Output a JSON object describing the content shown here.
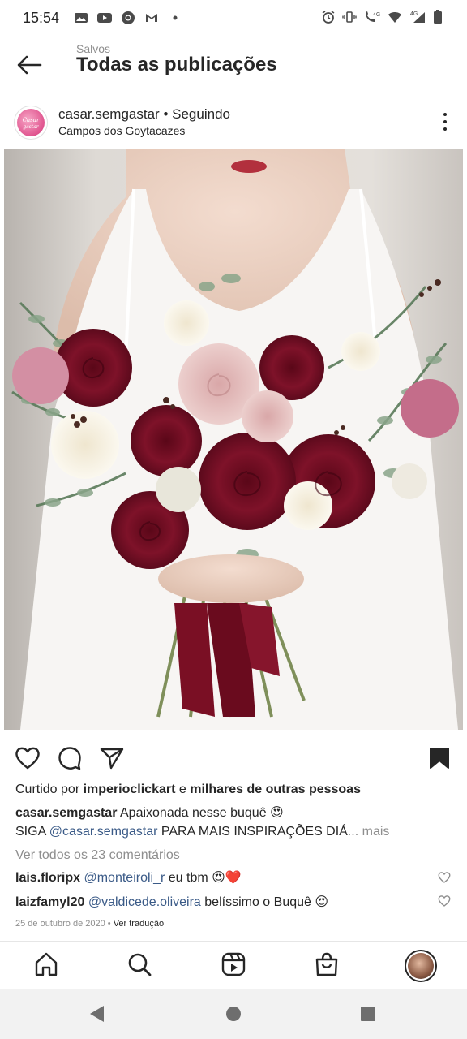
{
  "status_bar": {
    "time": "15:54",
    "left_icons": [
      "gallery-icon",
      "youtube-icon",
      "chrome-icon",
      "gmail-icon",
      "dot-icon"
    ],
    "right_icons": [
      "alarm-icon",
      "vibrate-icon",
      "call-4g-icon",
      "wifi-icon",
      "signal-4g-icon",
      "battery-icon"
    ],
    "network_label": "4G"
  },
  "header": {
    "subtitle": "Salvos",
    "title": "Todas as publicações"
  },
  "post": {
    "username": "casar.semgastar",
    "separator": " • ",
    "follow_status": "Seguindo",
    "location": "Campos dos Goytacazes",
    "avatar_text": "Casar Sem Gastar",
    "likes_prefix": "Curtido por ",
    "likes_user": "imperioclickart",
    "likes_middle": " e ",
    "likes_suffix": "milhares de outras pessoas",
    "caption_user": "casar.semgastar",
    "caption_text": " Apaixonada nesse buquê 😍",
    "caption_line2_prefix": "SIGA ",
    "caption_mention": "@casar.semgastar",
    "caption_line2_rest": " PARA MAIS INSPIRAÇÕES DIÁ",
    "ellipsis_more": "... mais",
    "view_comments": "Ver todos os 23 comentários",
    "comments": [
      {
        "user": "lais.floripx",
        "mention": "@monteiroli_r",
        "text": " eu tbm 😍❤️"
      },
      {
        "user": "laizfamyl20",
        "mention": "@valdicede.oliveira",
        "text": " belíssimo o Buquê 😍"
      }
    ],
    "date": "25 de outubro de 2020",
    "date_sep": " • ",
    "translate": "Ver tradução"
  },
  "colors": {
    "text": "#262626",
    "muted": "#8e8e8e",
    "mention": "#3a5a87",
    "rose": "#7a0f24",
    "heart": "#e0245e"
  }
}
